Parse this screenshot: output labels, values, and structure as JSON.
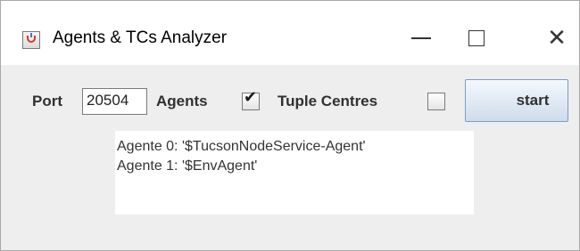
{
  "window": {
    "title": "Agents & TCs Analyzer",
    "icon": "java-cup-icon",
    "controls": {
      "minimize": "minimize-icon",
      "maximize": "maximize-icon",
      "close_glyph": "✕"
    }
  },
  "toolbar": {
    "port_label": "Port",
    "port_value": "20504",
    "agents_label": "Agents",
    "agents_checked": true,
    "agents_check_glyph": "✔",
    "tuple_centres_label": "Tuple Centres",
    "tuple_centres_checked": false,
    "start_label": "start"
  },
  "output": {
    "lines": [
      "Agente 0: '$TucsonNodeService-Agent'",
      "Agente 1: '$EnvAgent'"
    ]
  },
  "colors": {
    "window_background": "#eeeeee",
    "titlebar_background": "#ffffff",
    "button_border": "#7d9cc4",
    "text_area_background": "#ffffff"
  }
}
